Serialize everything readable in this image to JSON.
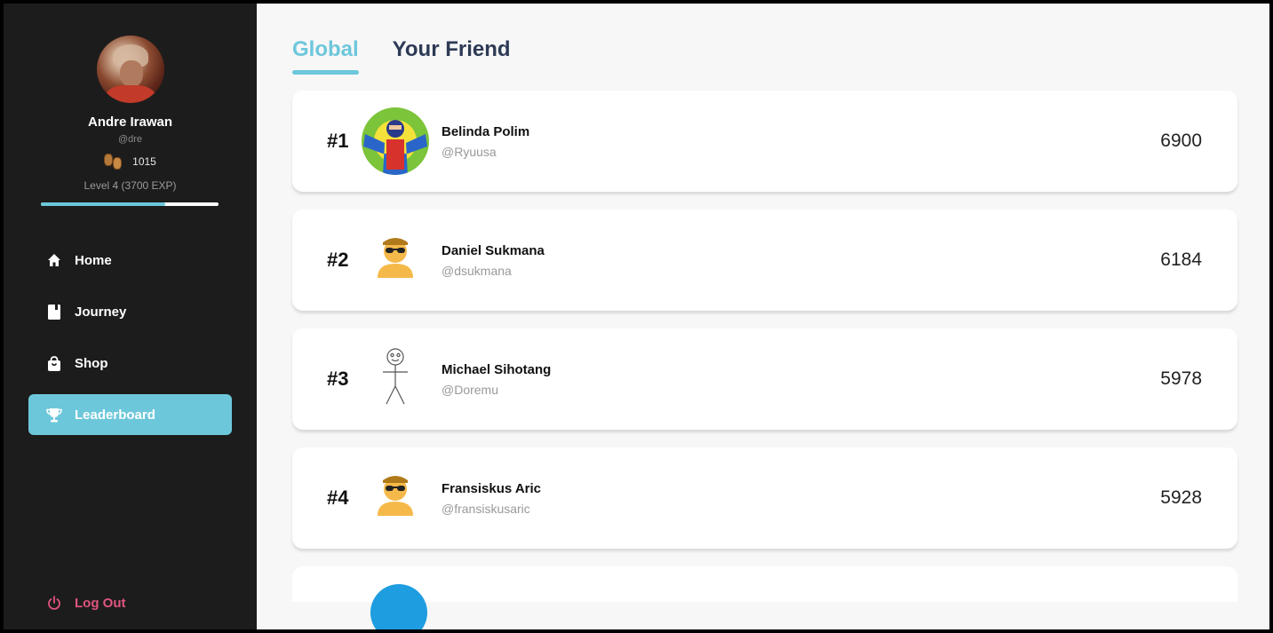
{
  "profile": {
    "name": "Andre Irawan",
    "handle": "@dre",
    "coins": "1015",
    "level_text": "Level 4 (3700 EXP)",
    "level_progress_fraction": 0.7
  },
  "nav": {
    "items": [
      {
        "label": "Home",
        "icon": "home-icon"
      },
      {
        "label": "Journey",
        "icon": "book-icon"
      },
      {
        "label": "Shop",
        "icon": "shopping-bag-icon"
      },
      {
        "label": "Leaderboard",
        "icon": "trophy-icon",
        "active": true
      }
    ],
    "logout": "Log Out"
  },
  "tabs": [
    {
      "label": "Global",
      "active": true
    },
    {
      "label": "Your Friend",
      "active": false
    }
  ],
  "leaderboard": [
    {
      "rank": "#1",
      "name": "Belinda Polim",
      "handle": "@Ryuusa",
      "score": "6900",
      "avatar": "superhero-avatar"
    },
    {
      "rank": "#2",
      "name": "Daniel Sukmana",
      "handle": "@dsukmana",
      "score": "6184",
      "avatar": "sunglasses-person-avatar"
    },
    {
      "rank": "#3",
      "name": "Michael Sihotang",
      "handle": "@Doremu",
      "score": "5978",
      "avatar": "stick-figure-avatar"
    },
    {
      "rank": "#4",
      "name": "Fransiskus Aric",
      "handle": "@fransiskusaric",
      "score": "5928",
      "avatar": "sunglasses-person-avatar"
    }
  ],
  "colors": {
    "sidebar_bg": "#1c1c1c",
    "accent": "#6dc7db",
    "logout": "#e0557e",
    "tab_inactive": "#2d3a55"
  }
}
